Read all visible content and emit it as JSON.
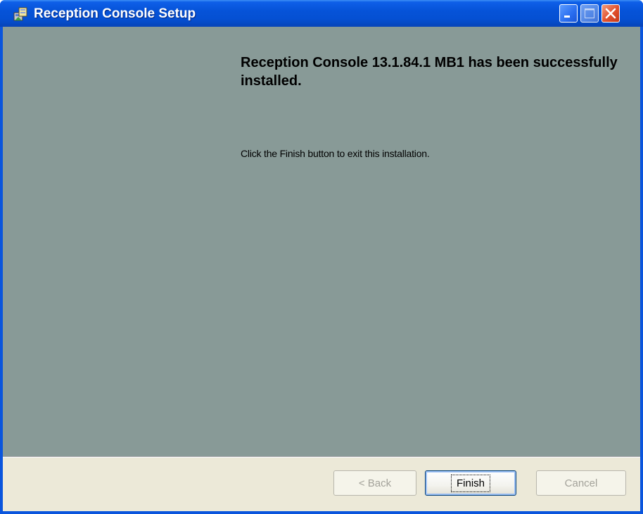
{
  "window": {
    "title": "Reception Console Setup",
    "icon": "installer-icon",
    "controls": {
      "minimize": "minimize-icon",
      "maximize": "maximize-icon",
      "close": "close-icon"
    }
  },
  "main": {
    "heading": "Reception Console 13.1.84.1 MB1 has been successfully installed.",
    "instruction": "Click the Finish button to exit this installation."
  },
  "buttons": {
    "back_label": "< Back",
    "finish_label": "Finish",
    "cancel_label": "Cancel"
  },
  "colors": {
    "titlebar": "#0653d8",
    "content_background": "#889a97",
    "footer_background": "#ece9d8",
    "close_button": "#e1502c"
  }
}
